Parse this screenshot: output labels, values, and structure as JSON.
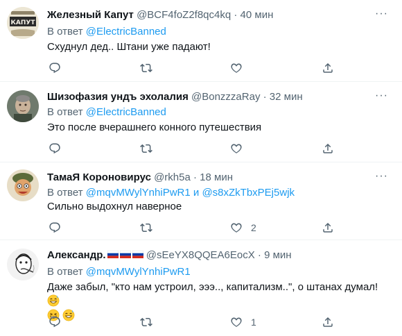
{
  "tweets": [
    {
      "name": "Железный Капут",
      "handle": "@BCF4foZ2f8qc4kq",
      "time": "40 мин",
      "reply_prefix": "В ответ",
      "reply_to": "@ElectricBanned",
      "text": "Схуднул дед.. Штани уже падают!",
      "avatar_text": "КАПУТ",
      "likes": ""
    },
    {
      "name": "Шизофазия ундъ эхолалия",
      "handle": "@BonzzzaRay",
      "time": "32 мин",
      "reply_prefix": "В ответ",
      "reply_to": "@ElectricBanned",
      "text": "Это после вчерашнего конного путешествия",
      "likes": ""
    },
    {
      "name": "ТамаЯ Короновирус",
      "handle": "@rkh5a",
      "time": "18 мин",
      "reply_prefix": "В ответ",
      "reply_to": "@mqvMWylYnhiPwR1",
      "reply_join": "и",
      "reply_to_2": "@s8xZkTbxPEj5wjk",
      "text": "Сильно выдохнул наверное",
      "likes": "2"
    },
    {
      "name": "Александр.",
      "handle": "@sEeYX8QQEA6EocX",
      "time": "9 мин",
      "reply_prefix": "В ответ",
      "reply_to": "@mqvMWylYnhiPwR1",
      "text": "Даже забыл, \"кто нам устроил, эээ.., капитализм..\", о штанах думал!",
      "likes": "1"
    }
  ],
  "ui": {
    "separator": "·",
    "more_glyph": "···",
    "icons": [
      "reply-icon",
      "retweet-icon",
      "like-icon",
      "share-icon",
      "more-icon"
    ],
    "colors": {
      "link": "#1d9bf0",
      "secondary": "#536471",
      "text": "#0f1419"
    }
  }
}
